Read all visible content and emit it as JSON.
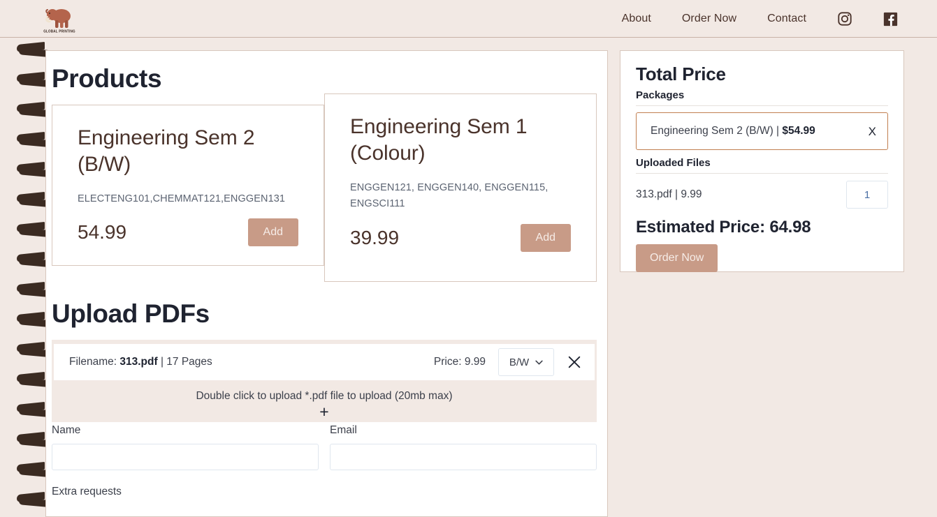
{
  "header": {
    "logo": {
      "name": "mammoth-logo",
      "wordmark": "GLOBAL PRINTING"
    },
    "nav": [
      {
        "label": "About",
        "name": "nav-about"
      },
      {
        "label": "Order Now",
        "name": "nav-order-now"
      },
      {
        "label": "Contact",
        "name": "nav-contact"
      }
    ],
    "social": [
      {
        "icon": "instagram-icon"
      },
      {
        "icon": "facebook-icon"
      }
    ]
  },
  "products": {
    "title": "Products",
    "add_label": "Add",
    "items": [
      {
        "title": "Engineering Sem 2 (B/W)",
        "courses": "ELECTENG101,CHEMMAT121,ENGGEN131",
        "price": "54.99"
      },
      {
        "title": "Engineering Sem 1 (Colour)",
        "courses": "ENGGEN121, ENGGEN140, ENGGEN115, ENGSCI111",
        "price": "39.99"
      }
    ]
  },
  "upload": {
    "title": "Upload PDFs",
    "file": {
      "prefix": "Filename: ",
      "name": "313.pdf",
      "pages": " | 17 Pages",
      "price_label": "Price: 9.99",
      "mode": "B/W",
      "close_icon": "close-icon"
    },
    "drop_hint": "Double click to upload *.pdf file to upload (20mb max)",
    "plus": "+"
  },
  "form": {
    "name_label": "Name",
    "name_value": "",
    "name_placeholder": "",
    "email_label": "Email",
    "email_value": "",
    "email_placeholder": "",
    "extra_label": "Extra requests"
  },
  "sidebar": {
    "title": "Total Price",
    "packages_heading": "Packages",
    "package": {
      "name": "Engineering Sem 2 (B/W) | ",
      "price": "$54.99",
      "remove": "X"
    },
    "uploaded_heading": "Uploaded Files",
    "uploaded_file": "313.pdf | 9.99",
    "quantity": "1",
    "estimated": "Estimated Price: 64.98",
    "order_label": "Order Now"
  },
  "colors": {
    "page_bg": "#f2e9e4",
    "accent": "#c89b87",
    "package_border": "#c17f50",
    "text_dark": "#1f2330",
    "brown": "#4a332b"
  }
}
